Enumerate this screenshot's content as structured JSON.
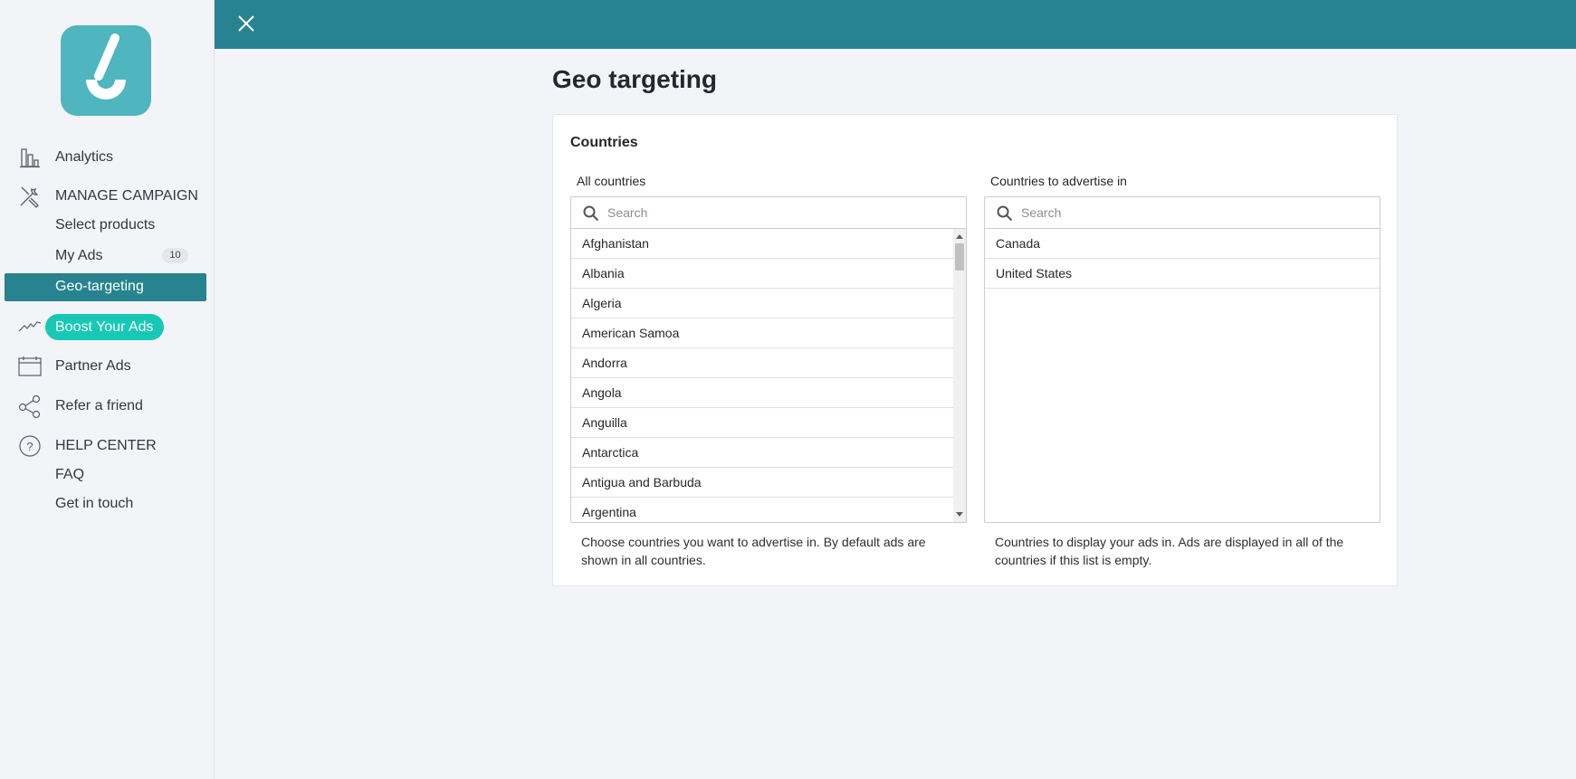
{
  "sidebar": {
    "logo": "app-logo",
    "nav": {
      "analytics": "Analytics",
      "manage_campaign": "MANAGE CAMPAIGN",
      "select_products": "Select products",
      "my_ads": "My Ads",
      "my_ads_count": "10",
      "geo_targeting": "Geo-targeting",
      "boost_your_ads": "Boost Your Ads",
      "partner_ads": "Partner Ads",
      "refer_a_friend": "Refer a friend",
      "help_center": "HELP CENTER",
      "faq": "FAQ",
      "get_in_touch": "Get in touch"
    }
  },
  "topbar": {
    "close_icon": "close-icon",
    "color": "#27838f"
  },
  "main": {
    "title": "Geo targeting",
    "card_title": "Countries",
    "all_countries": {
      "label": "All countries",
      "search_placeholder": "Search",
      "items": [
        "Afghanistan",
        "Albania",
        "Algeria",
        "American Samoa",
        "Andorra",
        "Angola",
        "Anguilla",
        "Antarctica",
        "Antigua and Barbuda",
        "Argentina"
      ],
      "help": "Choose countries you want to advertise in. By default ads are shown in all countries."
    },
    "selected_countries": {
      "label": "Countries to advertise in",
      "search_placeholder": "Search",
      "items": [
        "Canada",
        "United States"
      ],
      "help": "Countries to display your ads in. Ads are displayed in all of the countries if this list is empty."
    }
  },
  "colors": {
    "accent": "#27838f",
    "boost": "#17c9b4",
    "logo": "#4fb5bf"
  }
}
